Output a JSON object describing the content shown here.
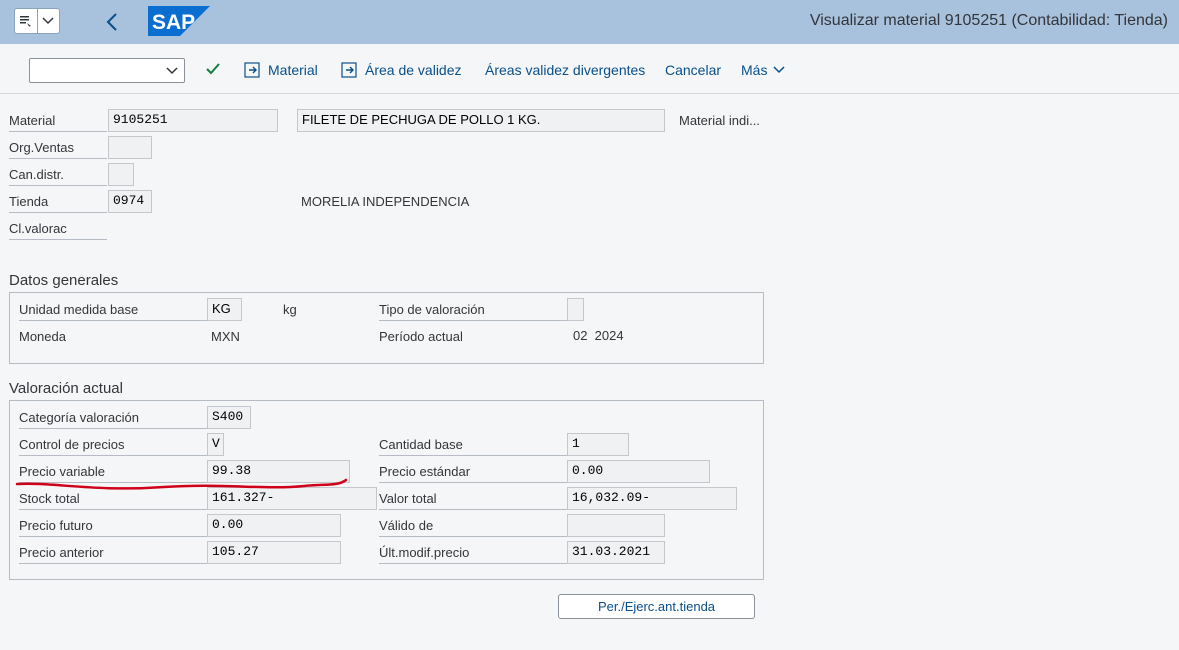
{
  "window": {
    "title": "Visualizar material 9105251 (Contabilidad: Tienda)",
    "logo_text": "SAP"
  },
  "toolbar": {
    "command_field_value": "",
    "material_label": "Material",
    "areas_validez_label": "Área de validez",
    "areas_divergentes_label": "Áreas validez divergentes",
    "cancelar_label": "Cancelar",
    "mas_label": "Más"
  },
  "header": {
    "material_label": "Material",
    "material_value": "9105251",
    "material_desc": "FILETE DE PECHUGA DE POLLO   1 KG.",
    "material_indi_label": "Material indi...",
    "org_ventas_label": "Org.Ventas",
    "org_ventas_value": "",
    "can_distr_label": "Can.distr.",
    "can_distr_value": "",
    "tienda_label": "Tienda",
    "tienda_value": "0974",
    "tienda_desc": "MORELIA INDEPENDENCIA",
    "cl_valorac_label": "Cl.valorac",
    "cl_valorac_value": ""
  },
  "datos_generales": {
    "title": "Datos generales",
    "unidad_label": "Unidad medida base",
    "unidad_value": "KG",
    "unidad_text": "kg",
    "tipo_valoracion_label": "Tipo de valoración",
    "tipo_valoracion_value": "",
    "moneda_label": "Moneda",
    "moneda_value": "MXN",
    "periodo_label": "Período actual",
    "periodo_value": "02  2024"
  },
  "valoracion_actual": {
    "title": "Valoración actual",
    "categoria_label": "Categoría valoración",
    "categoria_value": "S400",
    "control_label": "Control de precios",
    "control_value": "V",
    "cantidad_base_label": "Cantidad base",
    "cantidad_base_value": "1",
    "precio_variable_label": "Precio variable",
    "precio_variable_value": "99.38",
    "precio_estandar_label": "Precio estándar",
    "precio_estandar_value": "0.00",
    "stock_total_label": "Stock total",
    "stock_total_value": "161.327-",
    "valor_total_label": "Valor total",
    "valor_total_value": "16,032.09-",
    "precio_futuro_label": "Precio futuro",
    "precio_futuro_value": "0.00",
    "valido_de_label": "Válido de",
    "valido_de_value": "",
    "precio_anterior_label": "Precio anterior",
    "precio_anterior_value": "105.27",
    "ult_modif_label": "Últ.modif.precio",
    "ult_modif_value": "31.03.2021"
  },
  "footer": {
    "per_button_label": "Per./Ejerc.ant.tienda"
  },
  "colors": {
    "titlebar": "#a8c1dc",
    "link": "#0a4f8a",
    "check": "#107e3e",
    "annotation": "#d0021b"
  }
}
